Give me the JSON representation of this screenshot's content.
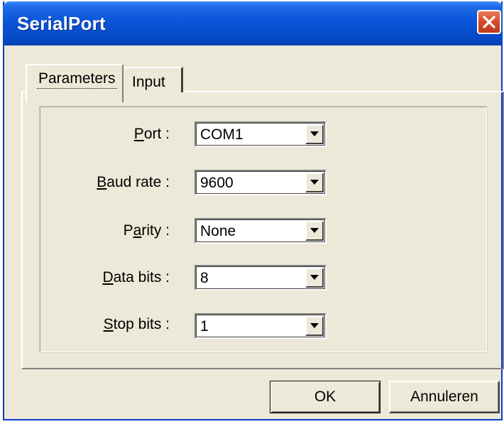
{
  "window": {
    "title": "SerialPort",
    "titlebar_color": "#0a55d8",
    "close_color": "#d6492a"
  },
  "tabs": [
    {
      "label": "Parameters",
      "selected": true
    },
    {
      "label": "Input",
      "selected": false
    }
  ],
  "fields": {
    "port": {
      "label_mnemonic": "P",
      "label_rest": "ort :",
      "value": "COM1"
    },
    "baud_rate": {
      "label_mnemonic": "B",
      "label_rest": "aud rate :",
      "value": "9600"
    },
    "parity": {
      "label_pre": "P",
      "label_mnemonic": "a",
      "label_rest": "rity :",
      "value": "None"
    },
    "data_bits": {
      "label_mnemonic": "D",
      "label_rest": "ata bits :",
      "value": "8"
    },
    "stop_bits": {
      "label_mnemonic": "S",
      "label_rest": "top bits :",
      "value": "1"
    }
  },
  "buttons": {
    "ok": "OK",
    "cancel": "Annuleren"
  },
  "icons": {
    "close": "close-icon",
    "dropdown": "dropdown-arrow-icon"
  }
}
